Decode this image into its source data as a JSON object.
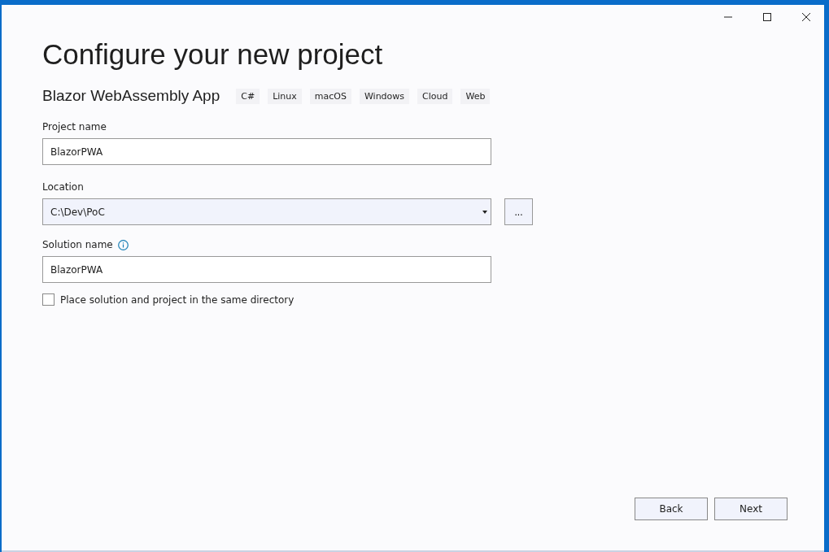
{
  "title": "Configure your new project",
  "template": {
    "name": "Blazor WebAssembly App",
    "tags": [
      "C#",
      "Linux",
      "macOS",
      "Windows",
      "Cloud",
      "Web"
    ]
  },
  "project_name": {
    "label": "Project name",
    "value": "BlazorPWA"
  },
  "location": {
    "label": "Location",
    "value": "C:\\Dev\\PoC",
    "browse": "..."
  },
  "solution_name": {
    "label": "Solution name",
    "value": "BlazorPWA"
  },
  "same_directory": {
    "label": "Place solution and project in the same directory",
    "checked": false
  },
  "buttons": [
    "Back",
    "Next"
  ]
}
